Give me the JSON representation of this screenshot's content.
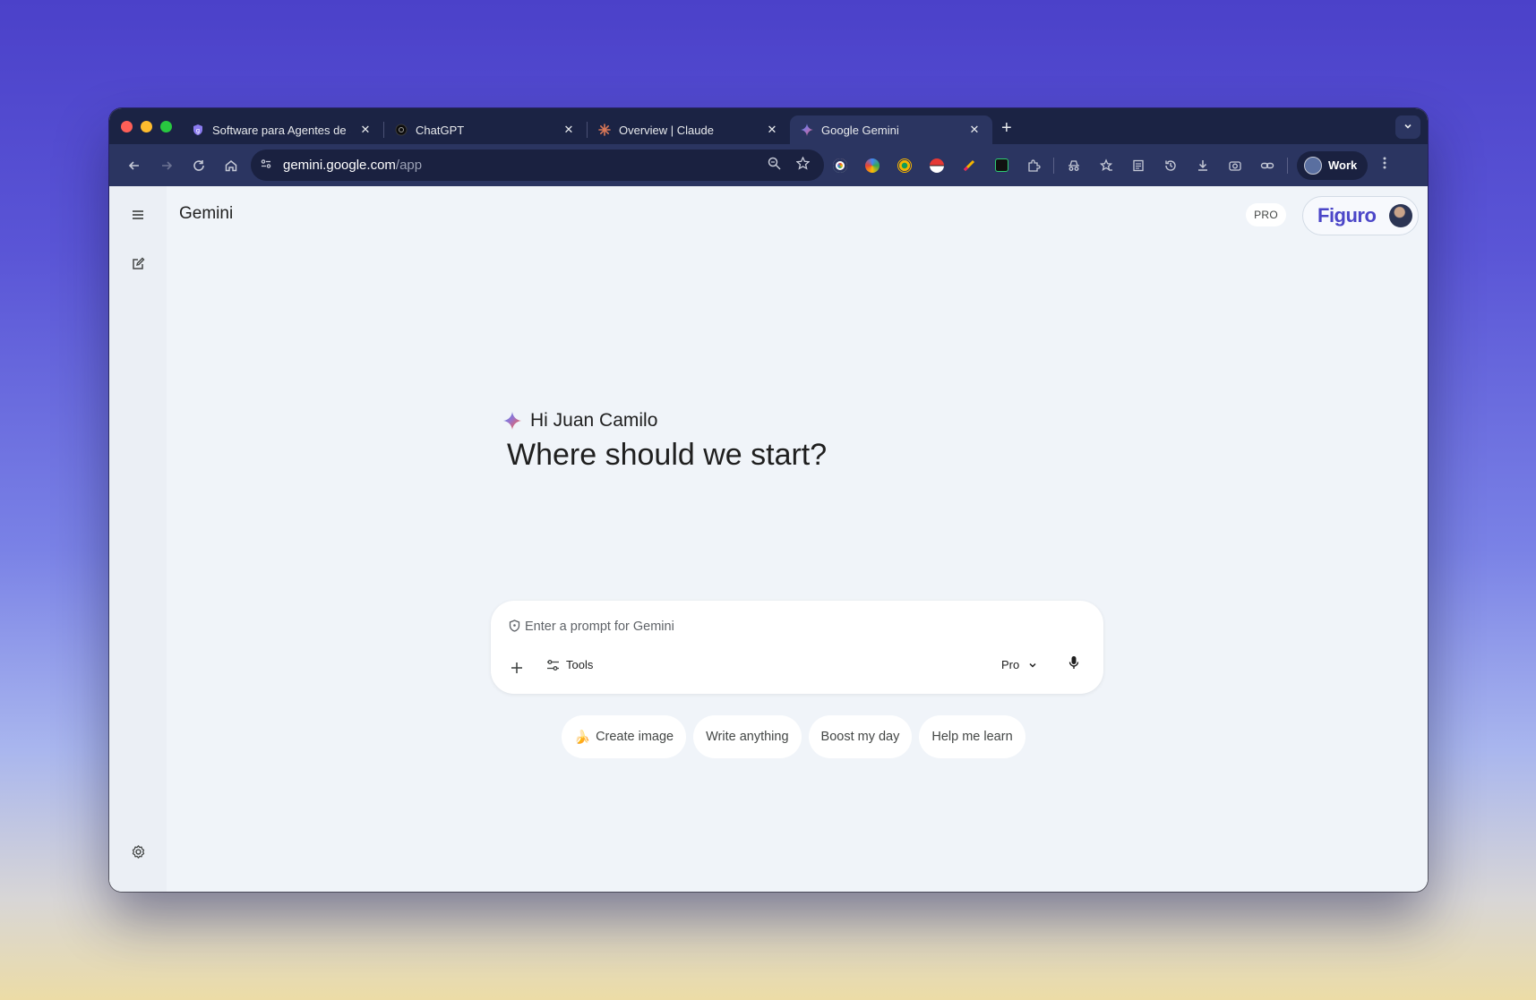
{
  "browser": {
    "tabs": [
      {
        "title": "Software para Agentes de Se",
        "icon": "shield-g-icon",
        "active": false
      },
      {
        "title": "ChatGPT",
        "icon": "chatgpt-icon",
        "active": false
      },
      {
        "title": "Overview | Claude",
        "icon": "claude-icon",
        "active": false
      },
      {
        "title": "Google Gemini",
        "icon": "gemini-icon",
        "active": true
      }
    ],
    "close_glyph": "✕",
    "new_tab_glyph": "+",
    "url_host": "gemini.google.com",
    "url_path": "/app",
    "profile_label": "Work"
  },
  "app": {
    "brand": "Gemini",
    "plan_badge": "PRO",
    "account_logo": "Figuro",
    "greeting": "Hi Juan Camilo",
    "headline": "Where should we start?",
    "prompt_placeholder": "Enter a prompt for Gemini",
    "tools_label": "Tools",
    "model_label": "Pro",
    "chips": [
      {
        "label": "Create image",
        "emoji": "🍌"
      },
      {
        "label": "Write anything"
      },
      {
        "label": "Boost my day"
      },
      {
        "label": "Help me learn"
      }
    ]
  },
  "colors": {
    "accent": "#4b46c8",
    "gemini_gradient": [
      "#4285f4",
      "#9b72cb",
      "#d96570",
      "#f4b400"
    ]
  }
}
